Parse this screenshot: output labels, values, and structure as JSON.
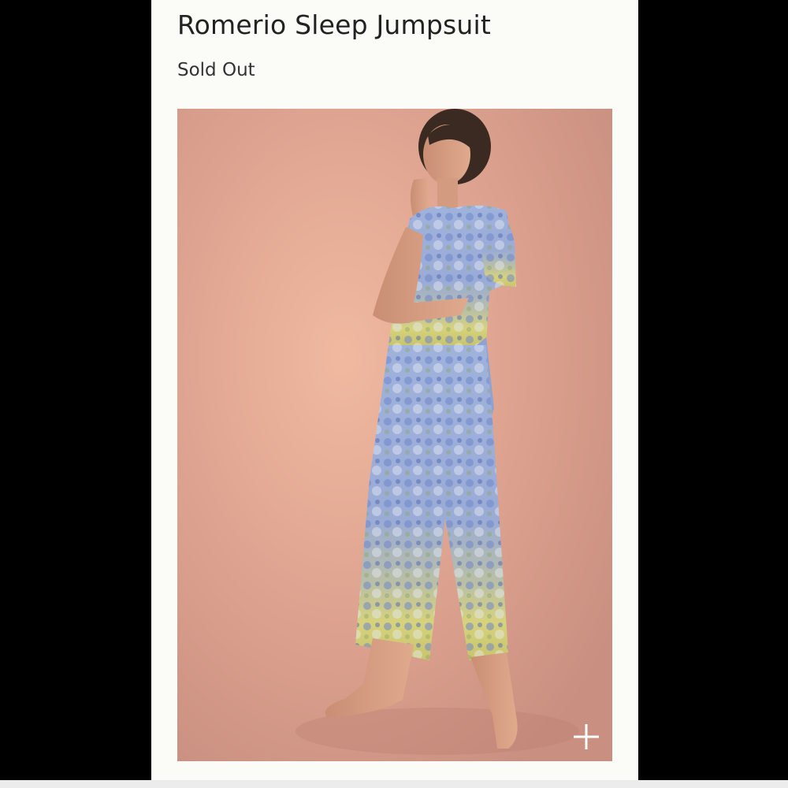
{
  "product": {
    "title": "Romerio Sleep Jumpsuit",
    "availability": "Sold Out"
  },
  "image": {
    "zoom_icon": "plus-icon"
  },
  "colors": {
    "page_background": "#000000",
    "card_background": "#fbfbf8",
    "photo_backdrop": "#dea794",
    "text": "#222222"
  }
}
